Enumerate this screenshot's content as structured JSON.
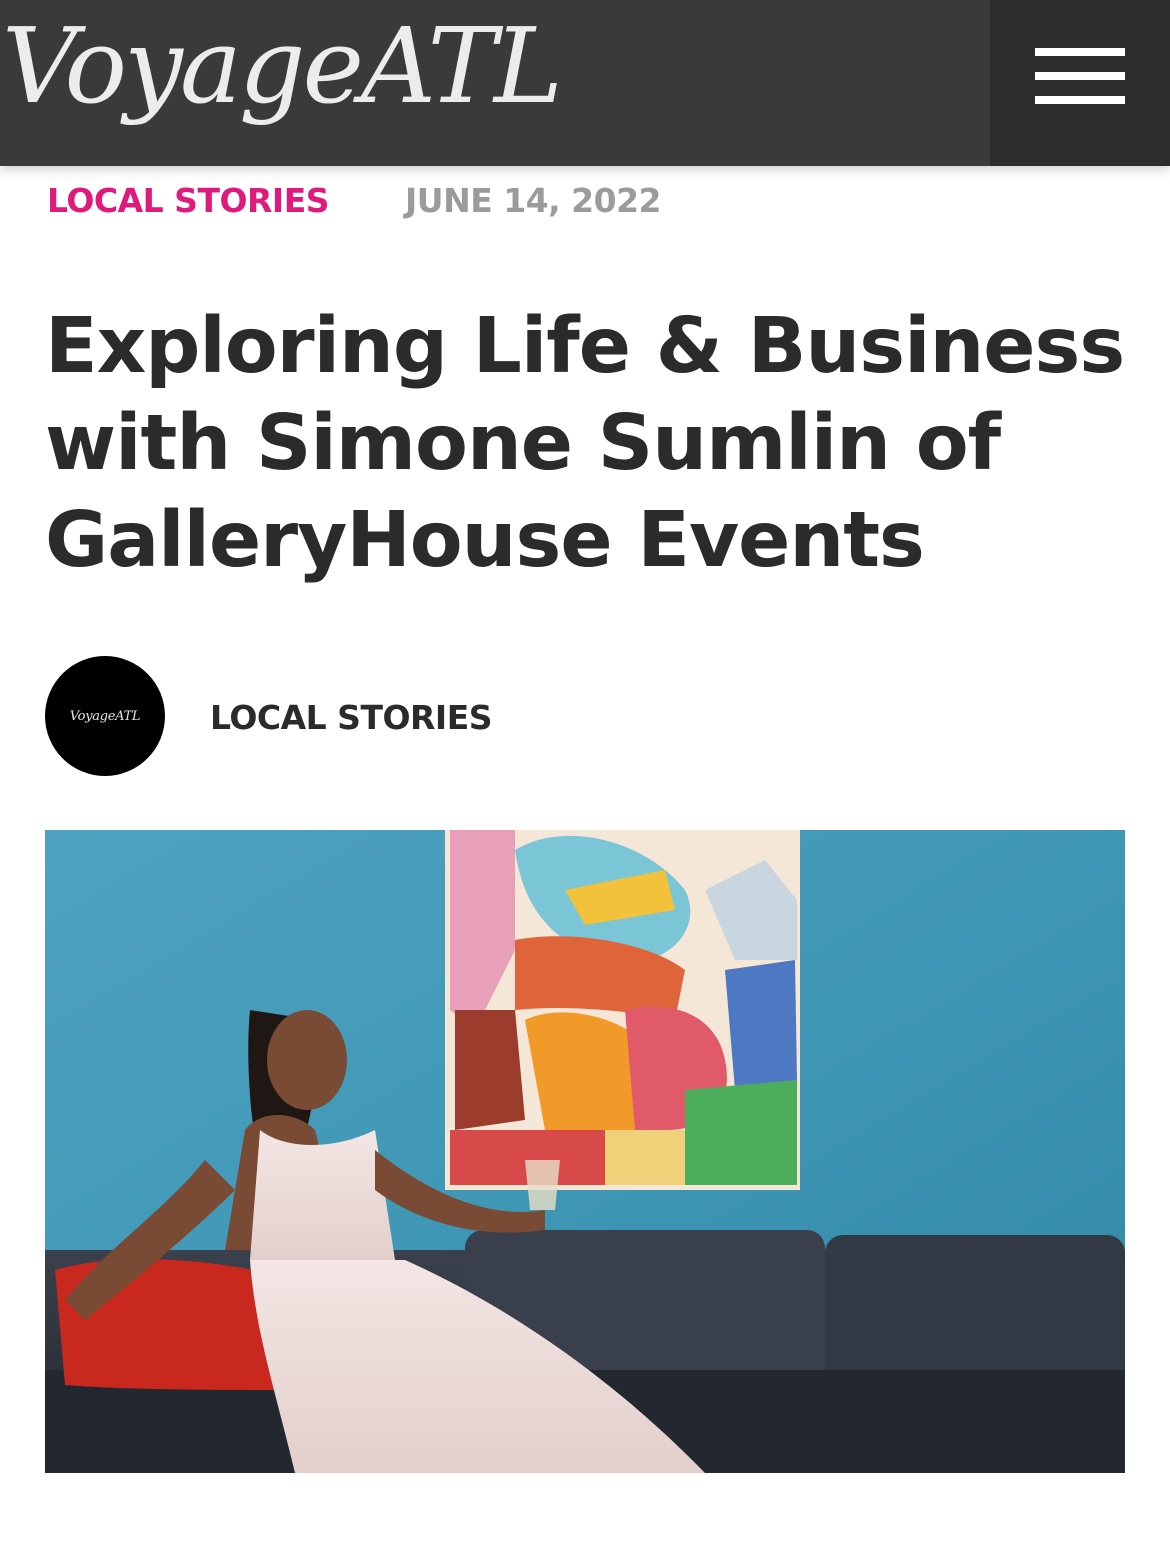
{
  "header": {
    "logo_text": "VoyageATL",
    "menu_icon": "hamburger-menu-icon"
  },
  "article": {
    "category": "LOCAL STORIES",
    "date": "JUNE 14, 2022",
    "title": "Exploring Life & Business with Simone Sumlin of GalleryHouse Events",
    "author": {
      "avatar_text": "VoyageATL",
      "name": "LOCAL STORIES"
    }
  },
  "colors": {
    "header_bg": "#3a3a3a",
    "menu_bg": "#2d2d2d",
    "category_accent": "#e0197d",
    "date_gray": "#9b9b9b",
    "title_text": "#2b2b2b"
  }
}
